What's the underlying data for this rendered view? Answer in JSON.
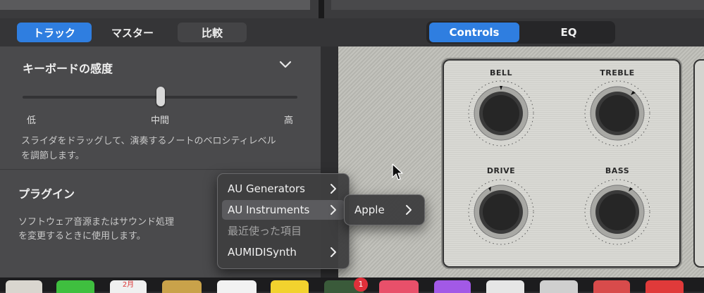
{
  "tabs": {
    "track": "トラック",
    "master": "マスター",
    "compare": "比較",
    "controls": "Controls",
    "eq": "EQ"
  },
  "keyboard": {
    "title": "キーボードの感度",
    "slider_value": 0.5,
    "low": "低",
    "mid": "中間",
    "high": "高",
    "desc1": "スライダをドラッグして、演奏するノートのベロシティレベル",
    "desc2": "を調節します。"
  },
  "plugin": {
    "title": "プラグイン",
    "desc1": "ソフトウェア音源またはサウンド処理",
    "desc2": "を変更するときに使用します。"
  },
  "menu": {
    "items": [
      "AU Generators",
      "AU Instruments",
      "最近使った項目",
      "AUMIDISynth"
    ]
  },
  "submenu": {
    "item": "Apple"
  },
  "knobs": {
    "bell": "BELL",
    "treble": "TREBLE",
    "drive": "DRIVE",
    "bass": "BASS"
  },
  "dock": {
    "calendar_month": "2月",
    "badge": "1"
  },
  "colors": {
    "accent": "#2f7ee0",
    "badge": "#e0303a"
  }
}
